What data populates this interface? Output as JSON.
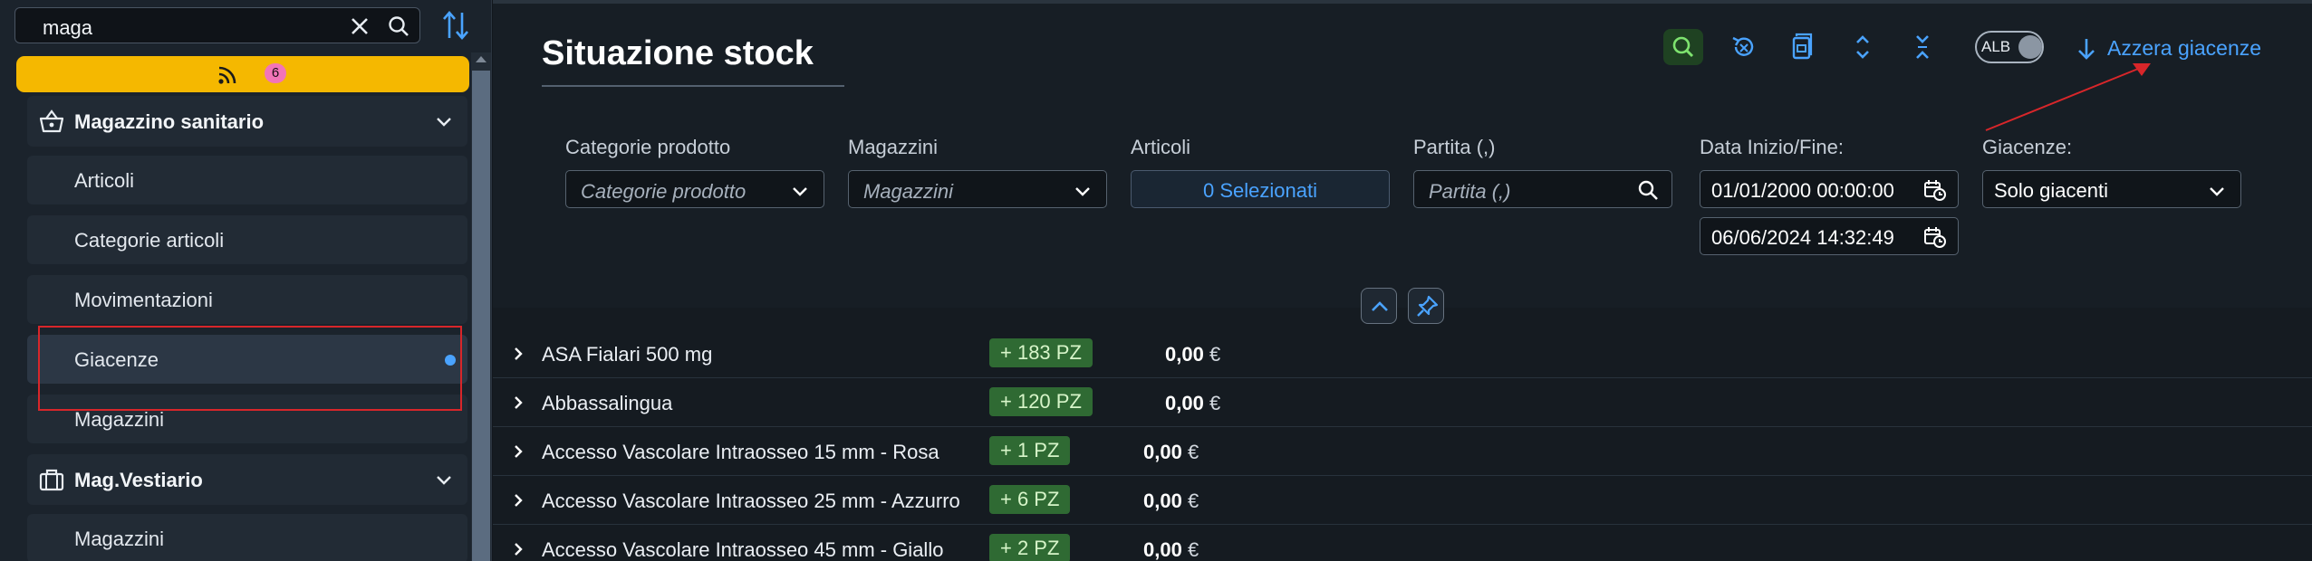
{
  "sidebar": {
    "search": {
      "value": "maga"
    },
    "feed": {
      "badge": "6"
    },
    "groups": [
      {
        "label": "Magazzino sanitario",
        "icon": "basket-icon"
      },
      {
        "label": "Mag.Vestiario",
        "icon": "briefcase-icon"
      }
    ],
    "items": [
      {
        "label": "Articoli"
      },
      {
        "label": "Categorie articoli"
      },
      {
        "label": "Movimentazioni"
      },
      {
        "label": "Giacenze"
      },
      {
        "label": "Magazzini"
      },
      {
        "label": "Magazzini"
      }
    ]
  },
  "main": {
    "title": "Situazione stock",
    "toolbar": {
      "toggle_label": "ALB",
      "reset_label": "Azzera giacenze"
    },
    "filters": {
      "categorie": {
        "label": "Categorie prodotto",
        "placeholder": "Categorie prodotto"
      },
      "magazzini": {
        "label": "Magazzini",
        "placeholder": "Magazzini"
      },
      "articoli": {
        "label": "Articoli",
        "selected": "0 Selezionati"
      },
      "partita": {
        "label": "Partita (,)",
        "placeholder": "Partita (,)"
      },
      "date": {
        "label": "Data Inizio/Fine:",
        "start": "01/01/2000 00:00:00",
        "end": "06/06/2024 14:32:49"
      },
      "giacenze": {
        "label": "Giacenze:",
        "value": "Solo giacenti"
      }
    },
    "rows": [
      {
        "name": "ASA Fialari 500 mg",
        "qty": "+ 183 PZ",
        "amount": "0,00",
        "currency": "€"
      },
      {
        "name": "Abbassalingua",
        "qty": "+ 120 PZ",
        "amount": "0,00",
        "currency": "€"
      },
      {
        "name": "Accesso Vascolare Intraosseo 15 mm - Rosa",
        "qty": "+ 1 PZ",
        "amount": "0,00",
        "currency": "€"
      },
      {
        "name": "Accesso Vascolare Intraosseo 25 mm - Azzurro",
        "qty": "+ 6 PZ",
        "amount": "0,00",
        "currency": "€"
      },
      {
        "name": "Accesso Vascolare Intraosseo 45 mm - Giallo",
        "qty": "+ 2 PZ",
        "amount": "0,00",
        "currency": "€"
      }
    ]
  },
  "colors": {
    "accent": "#4aa3ff",
    "feed_bar": "#f5b800",
    "badge": "#f274b8",
    "qty_badge": "#2f6a33",
    "annotation": "#d8262a"
  }
}
